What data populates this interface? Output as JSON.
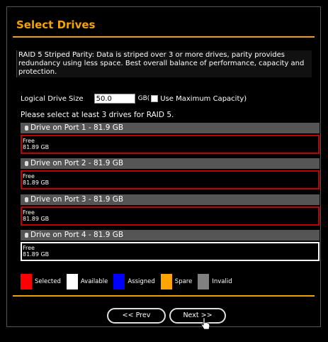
{
  "page": {
    "title": "Select Drives",
    "description": "RAID 5 Striped Parity: Data is striped over 3 or more drives, parity provides redundancy using less space. Best overall balance of performance, capacity and protection.",
    "logical_size_label": "Logical Drive Size",
    "logical_size_value": "50.0",
    "gb_label": "GB(",
    "max_capacity_label": "Use Maximum Capacity)",
    "hint": "Please select at least 3 drives for RAID 5."
  },
  "drives": [
    {
      "name": "Drive on Port 1 - 81.9 GB",
      "status": "Free",
      "size": "81.89 GB",
      "state": "selected"
    },
    {
      "name": "Drive on Port 2 - 81.9 GB",
      "status": "Free",
      "size": "81.89 GB",
      "state": "selected"
    },
    {
      "name": "Drive on Port 3 - 81.9 GB",
      "status": "Free",
      "size": "81.89 GB",
      "state": "selected"
    },
    {
      "name": "Drive on Port 4 - 81.9 GB",
      "status": "Free",
      "size": "81.89 GB",
      "state": "available"
    }
  ],
  "legend": [
    {
      "label": "Selected",
      "color": "#ff0000"
    },
    {
      "label": "Available",
      "color": "#ffffff"
    },
    {
      "label": "Assigned",
      "color": "#0000ff"
    },
    {
      "label": "Spare",
      "color": "#ffa500"
    },
    {
      "label": "Invalid",
      "color": "#808080"
    }
  ],
  "buttons": {
    "prev": "<< Prev",
    "next": "Next >>"
  },
  "colors": {
    "accent": "#f0a000",
    "selected_border": "#c00000",
    "drive_header": "#555555"
  }
}
